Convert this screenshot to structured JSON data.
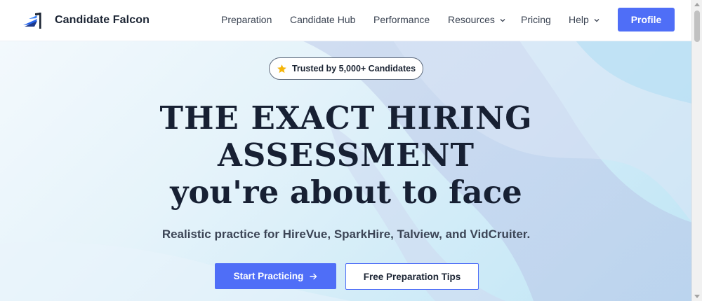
{
  "brand": {
    "name": "Candidate Falcon",
    "logo_icon": "flag-bird-logo-icon"
  },
  "nav": {
    "items": [
      {
        "label": "Preparation",
        "has_dropdown": false
      },
      {
        "label": "Candidate Hub",
        "has_dropdown": false
      },
      {
        "label": "Performance",
        "has_dropdown": false
      },
      {
        "label": "Resources",
        "has_dropdown": true
      },
      {
        "label": "Pricing",
        "has_dropdown": false
      },
      {
        "label": "Help",
        "has_dropdown": true
      }
    ],
    "profile_label": "Profile"
  },
  "hero": {
    "badge": {
      "icon": "star-icon",
      "text": "Trusted by 5,000+ Candidates"
    },
    "headline": {
      "line1": "THE EXACT HIRING",
      "line2": "ASSESSMENT",
      "line3": "you're about to face"
    },
    "subtitle": "Realistic practice for HireVue, SparkHire, Talview, and VidCruiter.",
    "primary_cta": "Start Practicing",
    "primary_cta_icon": "arrow-right-icon",
    "secondary_cta": "Free Preparation Tips"
  },
  "colors": {
    "accent": "#4f6ef7",
    "heading": "#172033",
    "star": "#f5b50a",
    "hero_bg": "#d2ecf8"
  }
}
